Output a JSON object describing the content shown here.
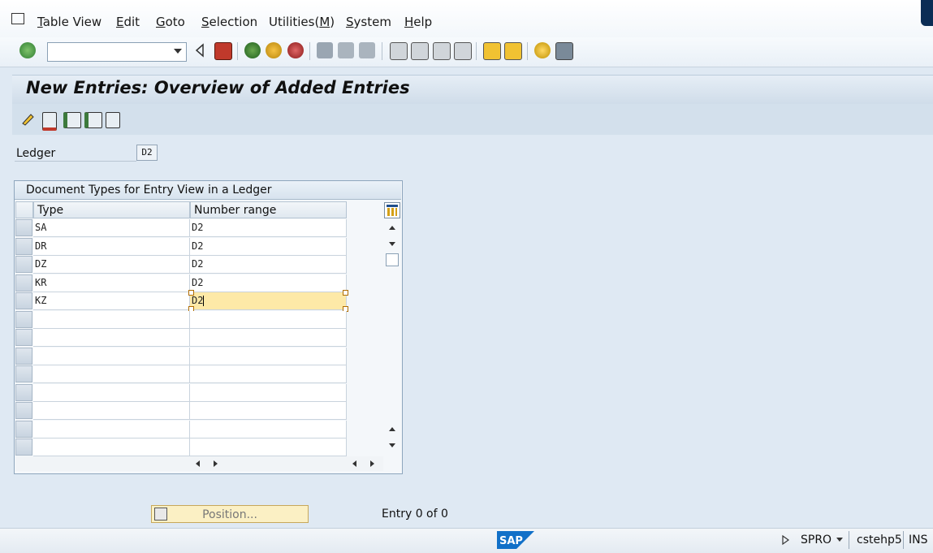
{
  "menubar": {
    "items": [
      {
        "label": "Table View",
        "ul": "T",
        "rest": "able View"
      },
      {
        "label": "Edit",
        "ul": "E",
        "rest": "dit"
      },
      {
        "label": "Goto",
        "ul": "G",
        "rest": "oto"
      },
      {
        "label": "Selection",
        "ul": "S",
        "rest": "election"
      },
      {
        "label": "Utilities(M)",
        "pre": "Utilities(",
        "ul": "M",
        "post": ")"
      },
      {
        "label": "System",
        "ul": "S",
        "rest": "ystem"
      },
      {
        "label": "Help",
        "ul": "H",
        "rest": "elp"
      }
    ]
  },
  "toolbar": {
    "command_field_value": "",
    "icons": [
      "enter-icon",
      "back-arrow-icon",
      "save-icon",
      "back-icon",
      "exit-icon",
      "cancel-icon",
      "print-icon",
      "find-icon",
      "find-next-icon",
      "first-page-icon",
      "previous-page-icon",
      "next-page-icon",
      "last-page-icon",
      "create-session-icon",
      "shortcut-icon",
      "help-icon",
      "layout-icon"
    ]
  },
  "page": {
    "title": "New Entries: Overview of Added Entries"
  },
  "app_toolbar": {
    "icons": [
      "change-display-icon",
      "delete-icon",
      "select-all-icon",
      "select-block-icon",
      "deselect-all-icon"
    ]
  },
  "ledger": {
    "label": "Ledger",
    "value": "D2"
  },
  "table": {
    "title": "Document Types for Entry View in a Ledger",
    "columns": [
      "Type",
      "Number range"
    ],
    "rows": [
      {
        "type": "SA",
        "number_range": "D2"
      },
      {
        "type": "DR",
        "number_range": "D2"
      },
      {
        "type": "DZ",
        "number_range": "D2"
      },
      {
        "type": "KR",
        "number_range": "D2"
      },
      {
        "type": "KZ",
        "number_range": "D2"
      },
      {
        "type": "",
        "number_range": ""
      },
      {
        "type": "",
        "number_range": ""
      },
      {
        "type": "",
        "number_range": ""
      },
      {
        "type": "",
        "number_range": ""
      },
      {
        "type": "",
        "number_range": ""
      },
      {
        "type": "",
        "number_range": ""
      },
      {
        "type": "",
        "number_range": ""
      },
      {
        "type": "",
        "number_range": ""
      }
    ],
    "active_row": 4
  },
  "footer": {
    "position_button": "Position...",
    "entry_count": "Entry 0 of 0"
  },
  "statusbar": {
    "logo_text": "SAP",
    "transaction": "SPRO",
    "server": "cstehp5",
    "mode": "INS"
  },
  "colors": {
    "brand_blue": "#1170c8",
    "active_cell": "#fde9a7",
    "background": "#dfe9f3"
  }
}
